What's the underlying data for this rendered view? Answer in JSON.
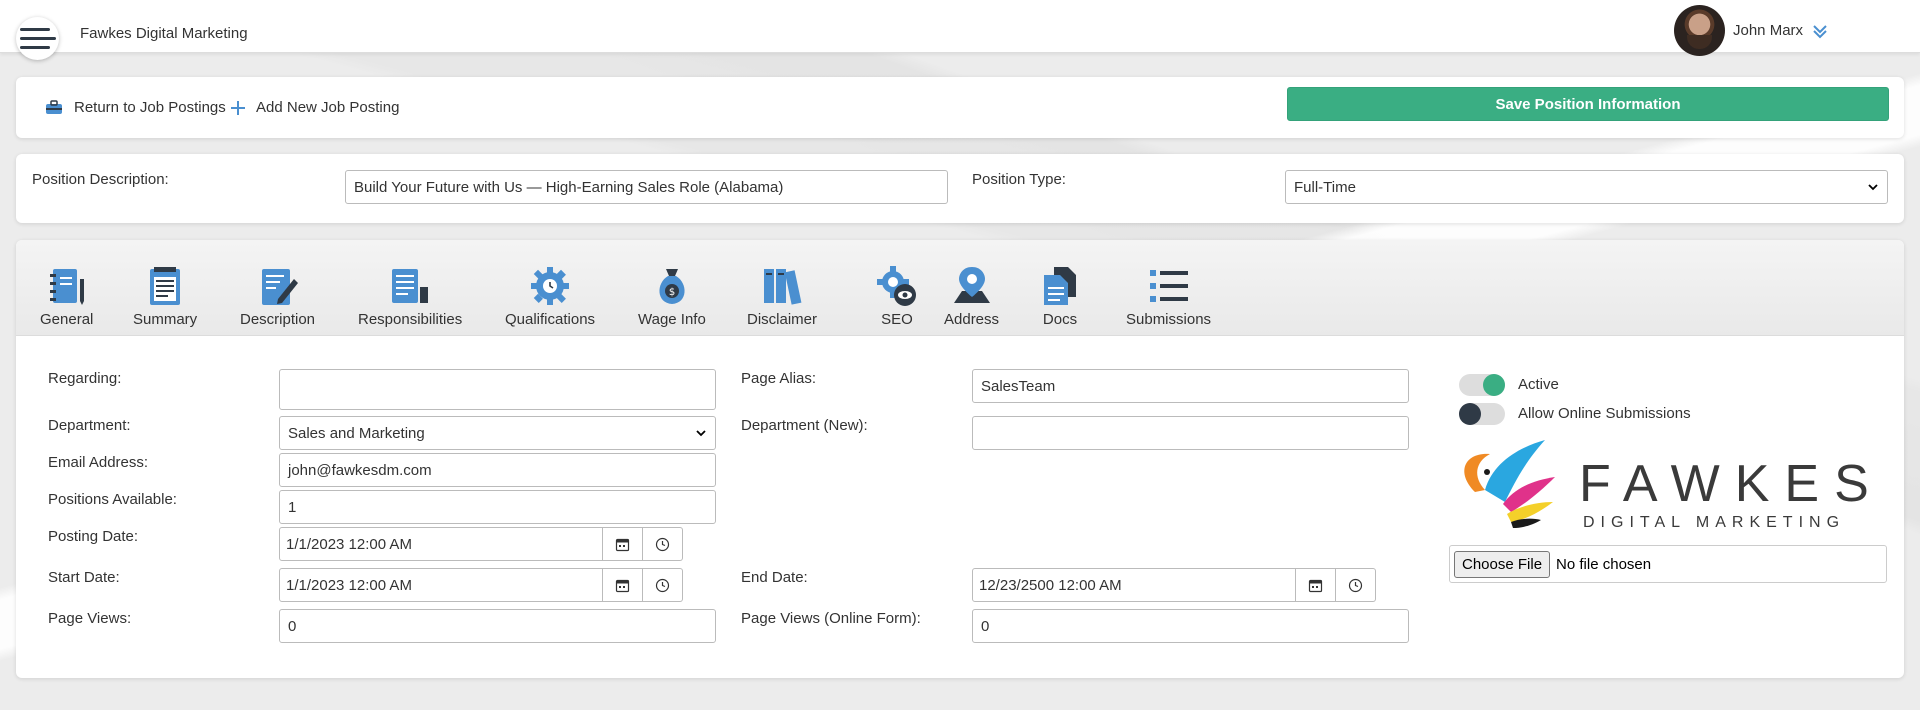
{
  "header": {
    "app_title": "Fawkes Digital Marketing",
    "user_name": "John Marx"
  },
  "actions": {
    "return_label": "Return to Job Postings",
    "add_label": "Add New Job Posting",
    "save_label": "Save Position Information"
  },
  "position": {
    "description_label": "Position Description:",
    "description_value": "Build Your Future with Us — High-Earning Sales Role (Alabama)",
    "type_label": "Position Type:",
    "type_value": "Full-Time"
  },
  "tabs": [
    {
      "label": "General",
      "icon": "notebook-icon"
    },
    {
      "label": "Summary",
      "icon": "clipboard-icon"
    },
    {
      "label": "Description",
      "icon": "document-edit-icon"
    },
    {
      "label": "Responsibilities",
      "icon": "documents-icon"
    },
    {
      "label": "Qualifications",
      "icon": "gear-clock-icon"
    },
    {
      "label": "Wage Info",
      "icon": "money-bag-icon"
    },
    {
      "label": "Disclaimer",
      "icon": "books-icon"
    },
    {
      "label": "SEO",
      "icon": "gear-eye-icon"
    },
    {
      "label": "Address",
      "icon": "map-pin-icon"
    },
    {
      "label": "Docs",
      "icon": "docs-icon"
    },
    {
      "label": "Submissions",
      "icon": "list-icon"
    }
  ],
  "form": {
    "regarding_label": "Regarding:",
    "regarding_value": "",
    "department_label": "Department:",
    "department_value": "Sales and Marketing",
    "email_label": "Email Address:",
    "email_value": "john@fawkesdm.com",
    "positions_label": "Positions Available:",
    "positions_value": "1",
    "posting_date_label": "Posting Date:",
    "posting_date_value": "1/1/2023 12:00 AM",
    "start_date_label": "Start Date:",
    "start_date_value": "1/1/2023 12:00 AM",
    "page_views_label": "Page Views:",
    "page_views_value": "0",
    "page_alias_label": "Page Alias:",
    "page_alias_value": "SalesTeam",
    "department_new_label": "Department (New):",
    "department_new_value": "",
    "end_date_label": "End Date:",
    "end_date_value": "12/23/2500 12:00 AM",
    "page_views_online_label": "Page Views (Online Form):",
    "page_views_online_value": "0"
  },
  "toggles": {
    "active_label": "Active",
    "active_on": true,
    "online_label": "Allow Online Submissions",
    "online_on": false
  },
  "logo": {
    "name": "FAWKES",
    "sub": "DIGITAL MARKETING"
  },
  "file_input": {
    "button_label": "Choose File",
    "status": "No file chosen"
  },
  "colors": {
    "accent": "#3aae83",
    "icon_blue": "#4a8fd0",
    "icon_dark": "#2f3a46"
  }
}
